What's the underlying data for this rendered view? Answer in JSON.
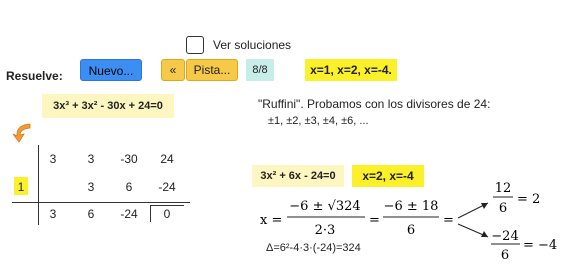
{
  "controls": {
    "show_solutions_label": "Ver soluciones",
    "resuelve_label": "Resuelve:",
    "nuevo_label": "Nuevo...",
    "prev_label": "«",
    "pista_label": "Pista...",
    "counter": "8/8",
    "answer": "x=1, x=2, x=-4."
  },
  "problem": {
    "equation": "3x³ + 3x² - 30x + 24=0",
    "ruffini_text": "\"Ruffini\". Probamos con los divisores de 24:",
    "divisors": "±1, ±2, ±3, ±4, ±6, ..."
  },
  "ruffini_table": {
    "coefficients": [
      "3",
      "3",
      "-30",
      "24"
    ],
    "root": "1",
    "products": [
      "3",
      "6",
      "-24"
    ],
    "results": [
      "3",
      "6",
      "-24"
    ],
    "remainder": "0"
  },
  "quadratic": {
    "equation": "3x² + 6x - 24=0",
    "solutions": "x=2, x=-4",
    "x_eq": "x =",
    "num1": "−6 ± √324",
    "den1": "2·3",
    "eq1": "=",
    "num2": "−6 ± 18",
    "den2": "6",
    "eq2": "=",
    "r1_num": "12",
    "r1_den": "6",
    "r1_val": "= 2",
    "r2_num": "−24",
    "r2_den": "6",
    "r2_val": "= −4",
    "discriminant": "Δ=6²-4·3·(-24)=324"
  }
}
